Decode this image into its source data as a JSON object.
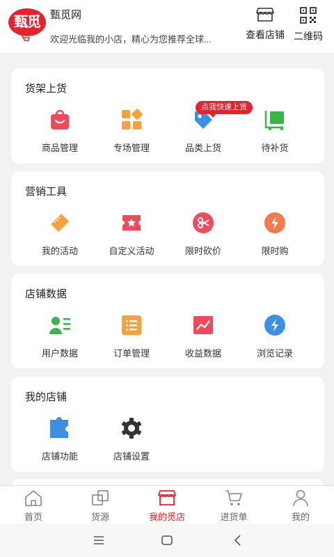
{
  "header": {
    "logo_text": "甄觅",
    "shop_name": "甄觅网",
    "shop_desc": "欢迎光临我的小店，精心为您推荐全球...",
    "view_shop_label": "查看店铺",
    "qrcode_label": "二维码"
  },
  "sections": [
    {
      "title": "货架上货",
      "items": [
        {
          "label": "商品管理",
          "icon": "bag-icon",
          "color": "#f04a5b"
        },
        {
          "label": "专场管理",
          "icon": "grid-icon",
          "color": "#f7a13c"
        },
        {
          "label": "品类上货",
          "icon": "tag-icon",
          "color": "#3d8fe6"
        },
        {
          "label": "待补货",
          "icon": "cart-icon",
          "color": "#39b54a"
        }
      ],
      "badge": "点我快速上货"
    },
    {
      "title": "营销工具",
      "items": [
        {
          "label": "我的活动",
          "icon": "ticket-icon",
          "color": "#f7a13c"
        },
        {
          "label": "自定义活动",
          "icon": "star-coupon-icon",
          "color": "#f04a5b"
        },
        {
          "label": "限时砍价",
          "icon": "cut-price-icon",
          "color": "#f04a5b"
        },
        {
          "label": "限时购",
          "icon": "flash-icon",
          "color": "#f57a4c"
        }
      ]
    },
    {
      "title": "店铺数据",
      "items": [
        {
          "label": "用户数据",
          "icon": "user-card-icon",
          "color": "#39b54a"
        },
        {
          "label": "订单管理",
          "icon": "list-icon",
          "color": "#f7a13c"
        },
        {
          "label": "收益数据",
          "icon": "chart-icon",
          "color": "#f04a5b"
        },
        {
          "label": "浏览记录",
          "icon": "flash-icon",
          "color": "#3d8fe6"
        }
      ]
    },
    {
      "title": "我的店铺",
      "items": [
        {
          "label": "店铺功能",
          "icon": "puzzle-icon",
          "color": "#3d8fe6"
        },
        {
          "label": "店铺设置",
          "icon": "gear-icon",
          "color": "#333333"
        }
      ]
    }
  ],
  "tabbar": {
    "tabs": [
      {
        "label": "首页",
        "icon": "home-icon"
      },
      {
        "label": "货源",
        "icon": "source-icon"
      },
      {
        "label": "我的觅店",
        "icon": "store-icon",
        "active": true
      },
      {
        "label": "进货单",
        "icon": "cart-icon"
      },
      {
        "label": "我的",
        "icon": "person-icon"
      }
    ]
  },
  "colors": {
    "accent": "#e4232c",
    "background": "#f2f2f2"
  }
}
